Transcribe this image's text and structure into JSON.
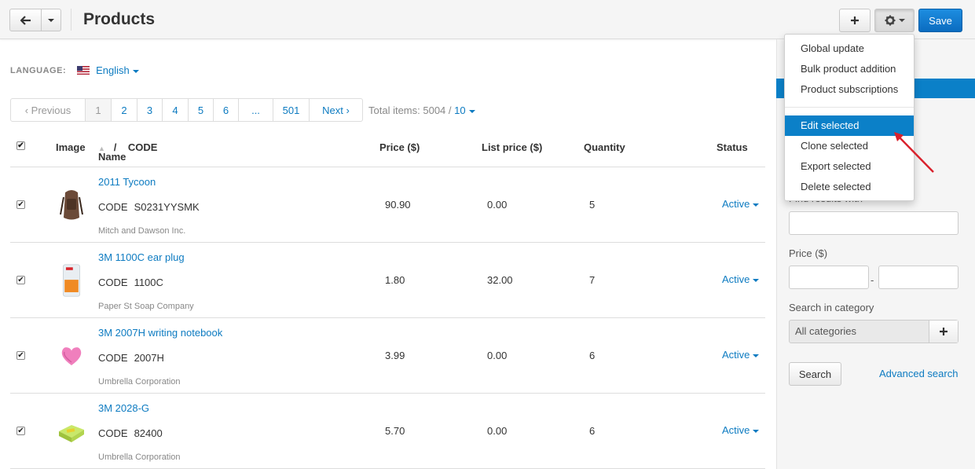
{
  "header": {
    "title": "Products",
    "add_label": "+",
    "save_label": "Save"
  },
  "language": {
    "label": "LANGUAGE:",
    "value": "English"
  },
  "pagination": {
    "previous": "‹ Previous",
    "pages": [
      "1",
      "2",
      "3",
      "4",
      "5",
      "6",
      "...",
      "501"
    ],
    "next": "Next ›",
    "total_label": "Total items: 5004 / ",
    "per_page": "10"
  },
  "table": {
    "columns": {
      "image": "Image",
      "name": "Name",
      "name_sep": "/",
      "code": "CODE",
      "price": "Price ($)",
      "list_price": "List price ($)",
      "quantity": "Quantity",
      "status": "Status"
    },
    "rows": [
      {
        "name": "2011 Tycoon",
        "code_label": "CODE",
        "code": "S0231YYSMK",
        "vendor": "Mitch and Dawson Inc.",
        "price": "90.90",
        "list_price": "0.00",
        "quantity": "5",
        "status": "Active"
      },
      {
        "name": "3M 1100C ear plug",
        "code_label": "CODE",
        "code": "1100C",
        "vendor": "Paper St Soap Company",
        "price": "1.80",
        "list_price": "32.00",
        "quantity": "7",
        "status": "Active"
      },
      {
        "name": "3M 2007H writing notebook",
        "code_label": "CODE",
        "code": "2007H",
        "vendor": "Umbrella Corporation",
        "price": "3.99",
        "list_price": "0.00",
        "quantity": "6",
        "status": "Active"
      },
      {
        "name": "3M 2028-G",
        "code_label": "CODE",
        "code": "82400",
        "vendor": "Umbrella Corporation",
        "price": "5.70",
        "list_price": "0.00",
        "quantity": "6",
        "status": "Active"
      }
    ]
  },
  "dropdown": {
    "items": [
      "Global update",
      "Bulk product addition",
      "Product subscriptions",
      "Edit selected",
      "Clone selected",
      "Export selected",
      "Delete selected"
    ],
    "active": "Edit selected"
  },
  "sidebar": {
    "find_label": "Find results with",
    "price_label": "Price ($)",
    "price_sep": "-",
    "category_label": "Search in category",
    "category_value": "All categories",
    "search_label": "Search",
    "advanced_label": "Advanced search"
  },
  "colors": {
    "link": "#0d7bc1",
    "accent": "#0b80c8",
    "annotation_arrow": "#d9212c"
  }
}
